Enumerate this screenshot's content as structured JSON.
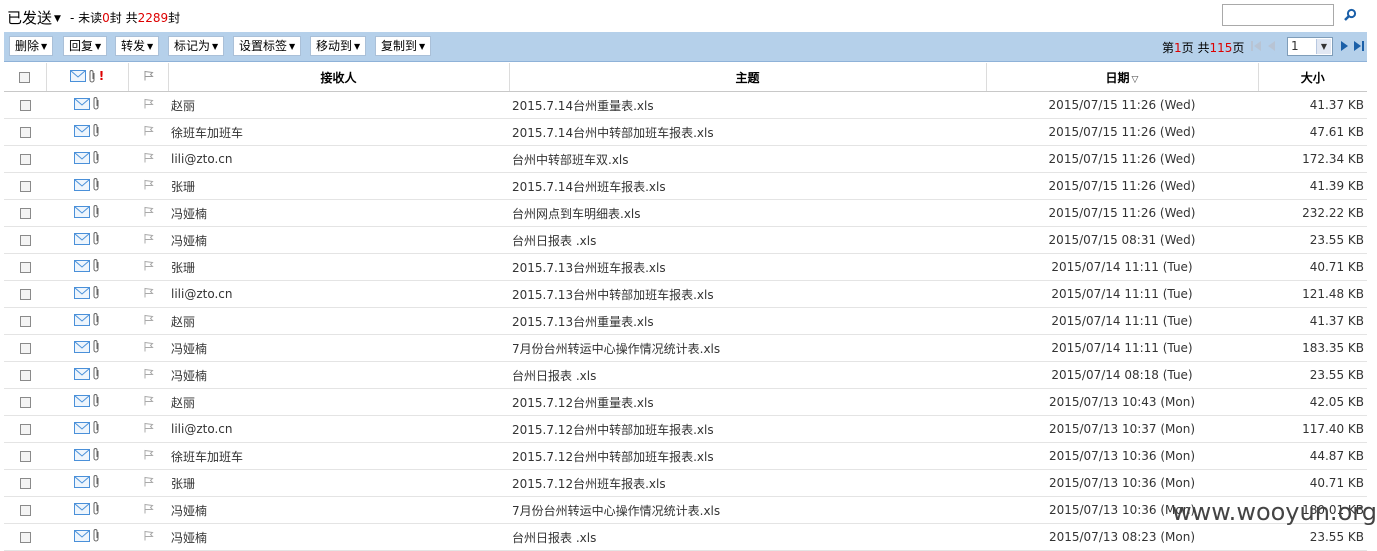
{
  "folder": {
    "name": "已发送"
  },
  "summary": {
    "prefix": "- 未读",
    "unread": "0",
    "mid": "封 共",
    "total": "2289",
    "suffix": "封"
  },
  "toolbar": {
    "delete": "删除",
    "reply": "回复",
    "forward": "转发",
    "mark_as": "标记为",
    "set_tag": "设置标签",
    "move_to": "移动到",
    "copy_to": "复制到"
  },
  "pager": {
    "prefix": "第",
    "current": "1",
    "mid": "页 共",
    "total": "115",
    "suffix": "页",
    "select_value": "1"
  },
  "columns": {
    "to": "接收人",
    "subject": "主题",
    "date": "日期",
    "size": "大小"
  },
  "colors": {
    "toolbar_bg": "#b5d0ea",
    "count_highlight": "#dd0000",
    "icon_blue": "#4a90d9"
  },
  "rows": [
    {
      "to": "赵丽",
      "subject": "2015.7.14台州重量表.xls",
      "date": "2015/07/15 11:26 (Wed)",
      "size": "41.37 KB"
    },
    {
      "to": "徐班车加班车",
      "subject": "2015.7.14台州中转部加班车报表.xls",
      "date": "2015/07/15 11:26 (Wed)",
      "size": "47.61 KB"
    },
    {
      "to": "lili@zto.cn",
      "subject": "台州中转部班车双.xls",
      "date": "2015/07/15 11:26 (Wed)",
      "size": "172.34 KB"
    },
    {
      "to": "张珊",
      "subject": "2015.7.14台州班车报表.xls",
      "date": "2015/07/15 11:26 (Wed)",
      "size": "41.39 KB"
    },
    {
      "to": "冯娅楠",
      "subject": "台州网点到车明细表.xls",
      "date": "2015/07/15 11:26 (Wed)",
      "size": "232.22 KB"
    },
    {
      "to": "冯娅楠",
      "subject": "台州日报表 .xls",
      "date": "2015/07/15 08:31 (Wed)",
      "size": "23.55 KB"
    },
    {
      "to": "张珊",
      "subject": "2015.7.13台州班车报表.xls",
      "date": "2015/07/14 11:11 (Tue)",
      "size": "40.71 KB"
    },
    {
      "to": "lili@zto.cn",
      "subject": "2015.7.13台州中转部加班车报表.xls",
      "date": "2015/07/14 11:11 (Tue)",
      "size": "121.48 KB"
    },
    {
      "to": "赵丽",
      "subject": "2015.7.13台州重量表.xls",
      "date": "2015/07/14 11:11 (Tue)",
      "size": "41.37 KB"
    },
    {
      "to": "冯娅楠",
      "subject": "7月份台州转运中心操作情况统计表.xls",
      "date": "2015/07/14 11:11 (Tue)",
      "size": "183.35 KB"
    },
    {
      "to": "冯娅楠",
      "subject": "台州日报表 .xls",
      "date": "2015/07/14 08:18 (Tue)",
      "size": "23.55 KB"
    },
    {
      "to": "赵丽",
      "subject": "2015.7.12台州重量表.xls",
      "date": "2015/07/13 10:43 (Mon)",
      "size": "42.05 KB"
    },
    {
      "to": "lili@zto.cn",
      "subject": "2015.7.12台州中转部加班车报表.xls",
      "date": "2015/07/13 10:37 (Mon)",
      "size": "117.40 KB"
    },
    {
      "to": "徐班车加班车",
      "subject": "2015.7.12台州中转部加班车报表.xls",
      "date": "2015/07/13 10:36 (Mon)",
      "size": "44.87 KB"
    },
    {
      "to": "张珊",
      "subject": "2015.7.12台州班车报表.xls",
      "date": "2015/07/13 10:36 (Mon)",
      "size": "40.71 KB"
    },
    {
      "to": "冯娅楠",
      "subject": "7月份台州转运中心操作情况统计表.xls",
      "date": "2015/07/13 10:36 (Mon)",
      "size": "180.01 KB"
    },
    {
      "to": "冯娅楠",
      "subject": "台州日报表 .xls",
      "date": "2015/07/13 08:23 (Mon)",
      "size": "23.55 KB"
    }
  ],
  "watermark": "www.wooyun.org"
}
